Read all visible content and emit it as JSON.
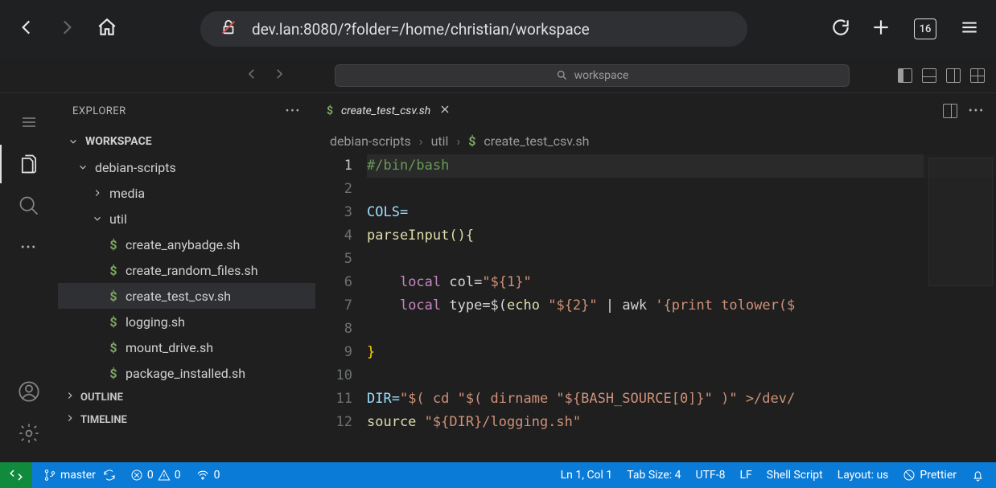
{
  "browser": {
    "url": "dev.lan:8080/?folder=/home/christian/workspace",
    "tab_count": "16"
  },
  "command_center": {
    "search_text": "workspace"
  },
  "sidebar": {
    "title": "EXPLORER",
    "workspace_label": "WORKSPACE",
    "folders": {
      "root": "debian-scripts",
      "media": "media",
      "util": "util"
    },
    "files": [
      "create_anybadge.sh",
      "create_random_files.sh",
      "create_test_csv.sh",
      "logging.sh",
      "mount_drive.sh",
      "package_installed.sh"
    ],
    "outline": "OUTLINE",
    "timeline": "TIMELINE"
  },
  "editor": {
    "tab_name": "create_test_csv.sh",
    "breadcrumb": [
      "debian-scripts",
      "util",
      "create_test_csv.sh"
    ],
    "lines": [
      "1",
      "2",
      "3",
      "4",
      "5",
      "6",
      "7",
      "8",
      "9",
      "10",
      "11",
      "12"
    ],
    "code": {
      "l1": "#/bin/bash",
      "l3": "COLS=",
      "l4": "parseInput(){",
      "l6a": "local",
      "l6b": " col=",
      "l6c": "\"${1}\"",
      "l7a": "local",
      "l7b": " type=$(",
      "l7c": "echo ",
      "l7d": "\"${2}\"",
      "l7e": " | awk ",
      "l7f": "'{print tolower($",
      "l9": "}",
      "l11a": "DIR=",
      "l11b": "\"$( cd \"$( dirname \"${BASH_SOURCE[0]}\" )\" >/dev/",
      "l12a": "source ",
      "l12b": "\"${DIR}/logging.sh\""
    }
  },
  "status": {
    "branch": "master",
    "errors": "0",
    "warnings": "0",
    "ports": "0",
    "ln_col": "Ln 1, Col 1",
    "tab_size": "Tab Size: 4",
    "encoding": "UTF-8",
    "eol": "LF",
    "lang": "Shell Script",
    "layout": "Layout: us",
    "prettier": "Prettier"
  }
}
